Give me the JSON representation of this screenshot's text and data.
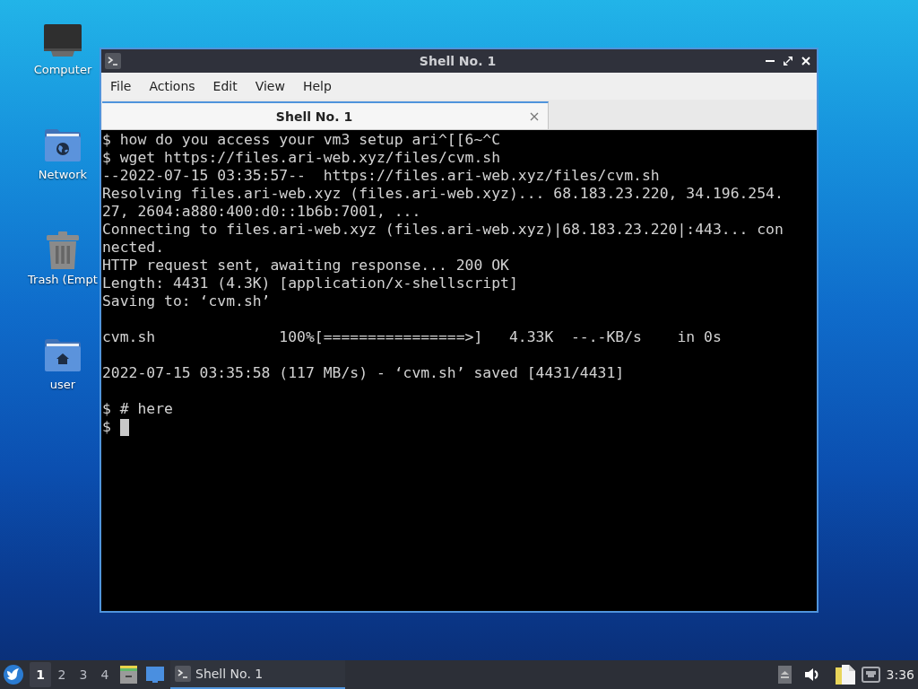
{
  "desktop_icons": [
    {
      "kind": "computer",
      "label": "Computer"
    },
    {
      "kind": "network",
      "label": "Network"
    },
    {
      "kind": "trash",
      "label": "Trash (Empt"
    },
    {
      "kind": "home",
      "label": "user"
    }
  ],
  "window": {
    "title": "Shell No. 1",
    "menu": [
      "File",
      "Actions",
      "Edit",
      "View",
      "Help"
    ],
    "tabs": [
      {
        "label": "Shell No. 1",
        "selected": true
      }
    ],
    "terminal": {
      "blocks": [
        {
          "lines": [
            "$ how do you access your vm3 setup ari^[[6~^C",
            "$ wget https://files.ari-web.xyz/files/cvm.sh",
            "--2022-07-15 03:35:57--  https://files.ari-web.xyz/files/cvm.sh",
            "Resolving files.ari-web.xyz (files.ari-web.xyz)... 68.183.23.220, 34.196.254.",
            "27, 2604:a880:400:d0::1b6b:7001, ...",
            "Connecting to files.ari-web.xyz (files.ari-web.xyz)|68.183.23.220|:443... con",
            "nected.",
            "HTTP request sent, awaiting response... 200 OK",
            "Length: 4431 (4.3K) [application/x-shellscript]",
            "Saving to: ‘cvm.sh’"
          ]
        },
        {
          "lines": [
            "cvm.sh              100%[================>]   4.33K  --.-KB/s    in 0s"
          ]
        },
        {
          "lines": [
            "2022-07-15 03:35:58 (117 MB/s) - ‘cvm.sh’ saved [4431/4431]"
          ]
        },
        {
          "lines": [
            "$ # here",
            "$"
          ]
        }
      ],
      "cursor": true
    }
  },
  "taskbar": {
    "workspaces": [
      {
        "label": "1",
        "selected": true
      },
      {
        "label": "2",
        "selected": false
      },
      {
        "label": "3",
        "selected": false
      },
      {
        "label": "4",
        "selected": false
      }
    ],
    "tasks": [
      {
        "label": "Shell No. 1",
        "active": true
      }
    ],
    "clock": "3:36"
  }
}
